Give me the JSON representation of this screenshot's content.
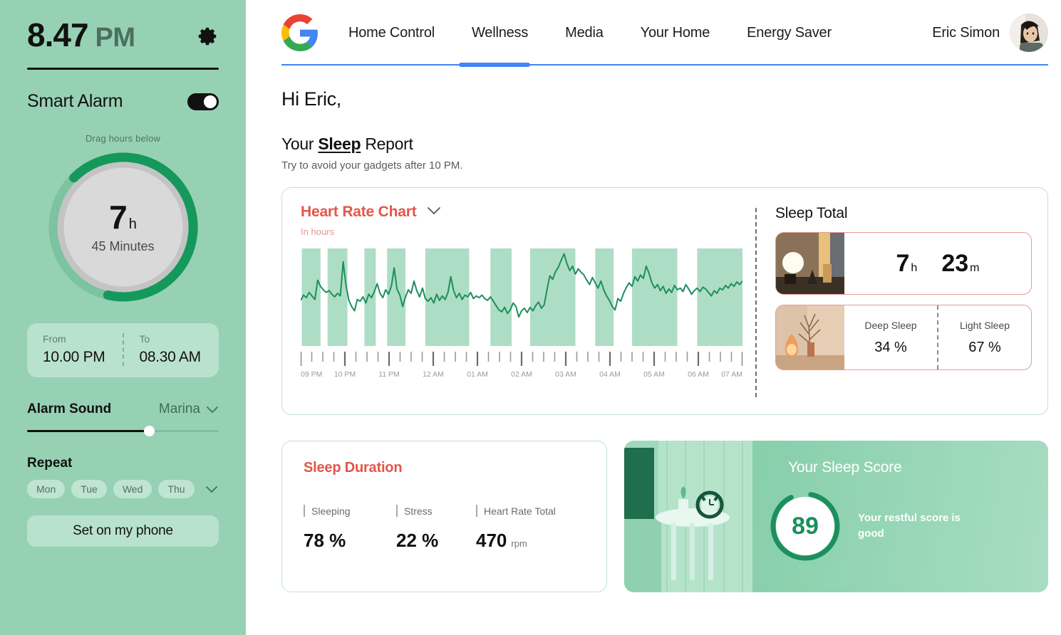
{
  "sidebar": {
    "clock": {
      "time": "8.47",
      "ampm": "PM"
    },
    "gear_icon": "gear-icon",
    "alarm": {
      "title": "Smart Alarm",
      "enabled": true
    },
    "drag_hint": "Drag hours below",
    "dial": {
      "hours": "7",
      "hours_unit": "h",
      "minutes": "45 Minutes",
      "progress_pct": 66
    },
    "schedule": {
      "from_label": "From",
      "from_value": "10.00 PM",
      "to_label": "To",
      "to_value": "08.30 AM"
    },
    "alarm_sound": {
      "label": "Alarm Sound",
      "value": "Marina",
      "chevron_icon": "chevron-down-icon",
      "volume_pct": 63
    },
    "repeat": {
      "label": "Repeat",
      "days": [
        "Mon",
        "Tue",
        "Wed",
        "Thu"
      ],
      "expand_icon": "chevron-down-icon"
    },
    "set_button": "Set on my phone"
  },
  "topnav": {
    "logo_icon": "google-logo-icon",
    "links": [
      "Home Control",
      "Wellness",
      "Media",
      "Your Home",
      "Energy Saver"
    ],
    "active_index": 1,
    "user_name": "Eric Simon",
    "avatar_icon": "avatar"
  },
  "header": {
    "greeting": "Hi  Eric,",
    "report_prefix": "Your ",
    "report_emphasis": "Sleep",
    "report_suffix": " Report",
    "report_sub": "Try to avoid your gadgets after 10  PM."
  },
  "chart_card": {
    "title": "Heart Rate Chart",
    "title_chevron_icon": "chevron-down-icon",
    "subtitle": "In hours"
  },
  "chart_data": {
    "type": "line",
    "title": "Heart Rate Chart",
    "subtitle": "In hours",
    "xlabel": "",
    "ylabel": "",
    "grid": false,
    "legend": "none",
    "tick_labels": [
      "09 PM",
      "10 PM",
      "11 PM",
      "12 AM",
      "01 AM",
      "02 AM",
      "03 AM",
      "04 AM",
      "05 AM",
      "06 AM",
      "07 AM"
    ],
    "ylim": [
      0,
      100
    ],
    "shaded_bands": [
      [
        0.4,
        7.0
      ],
      [
        9.5,
        16.5
      ],
      [
        22.5,
        26.5
      ],
      [
        30.5,
        37.0
      ],
      [
        44.0,
        59.5
      ],
      [
        67.0,
        74.5
      ],
      [
        81.0,
        97.0
      ],
      [
        104.0,
        110.5
      ],
      [
        117.0,
        133.0
      ],
      [
        140.0,
        159.0
      ]
    ],
    "values": [
      44,
      50,
      47,
      53,
      49,
      45,
      67,
      60,
      56,
      53,
      55,
      51,
      48,
      52,
      49,
      88,
      61,
      44,
      37,
      32,
      45,
      43,
      48,
      41,
      51,
      47,
      54,
      63,
      52,
      47,
      56,
      51,
      60,
      81,
      57,
      50,
      37,
      48,
      56,
      52,
      66,
      55,
      48,
      58,
      46,
      43,
      47,
      41,
      51,
      44,
      49,
      45,
      53,
      71,
      55,
      47,
      52,
      45,
      50,
      48,
      53,
      46,
      49,
      47,
      50,
      46,
      44,
      48,
      43,
      38,
      33,
      31,
      36,
      29,
      33,
      41,
      37,
      25,
      32,
      35,
      30,
      36,
      32,
      38,
      42,
      35,
      39,
      57,
      72,
      68,
      77,
      82,
      90,
      97,
      86,
      78,
      83,
      74,
      80,
      76,
      73,
      67,
      62,
      70,
      64,
      58,
      66,
      56,
      49,
      44,
      37,
      33,
      46,
      43,
      52,
      59,
      64,
      60,
      71,
      66,
      73,
      69,
      83,
      75,
      64,
      58,
      62,
      55,
      60,
      52,
      57,
      53,
      61,
      56,
      58,
      54,
      62,
      57,
      51,
      55,
      58,
      54,
      59,
      57,
      53,
      49,
      55,
      52,
      58,
      56,
      61,
      58,
      63,
      60,
      65,
      62,
      66
    ]
  },
  "sleep_total": {
    "title": "Sleep Total",
    "thumb_icon": "lamp-photo",
    "hours": "7",
    "hours_unit": "h",
    "minutes": "23",
    "minutes_unit": "m"
  },
  "sleep_split": {
    "thumb_icon": "salt-lamp-photo",
    "cells": [
      {
        "label": "Deep Sleep",
        "value": "34 %"
      },
      {
        "label": "Light Sleep",
        "value": "67 %"
      }
    ]
  },
  "sleep_duration": {
    "title": "Sleep Duration",
    "metrics": [
      {
        "label": "Sleeping",
        "value": "78 %",
        "unit": ""
      },
      {
        "label": "Stress",
        "value": "22 %",
        "unit": ""
      },
      {
        "label": "Heart Rate Total",
        "value": "470",
        "unit": "rpm"
      }
    ]
  },
  "sleep_score": {
    "title": "Your Sleep Score",
    "photo_icon": "bedroom-clock-photo",
    "score": "89",
    "score_pct": 89,
    "message": "Your restful score is good"
  },
  "colors": {
    "sidebar_bg": "#97d1b4",
    "sidebar_panel": "#b9e2ce",
    "accent_green": "#1d8f5e",
    "accent_red": "#e2564a",
    "nav_blue": "#4285f4",
    "card_border": "#bfe3d0",
    "pink_border": "#e79b92",
    "chart_band": "#aeddc5"
  }
}
